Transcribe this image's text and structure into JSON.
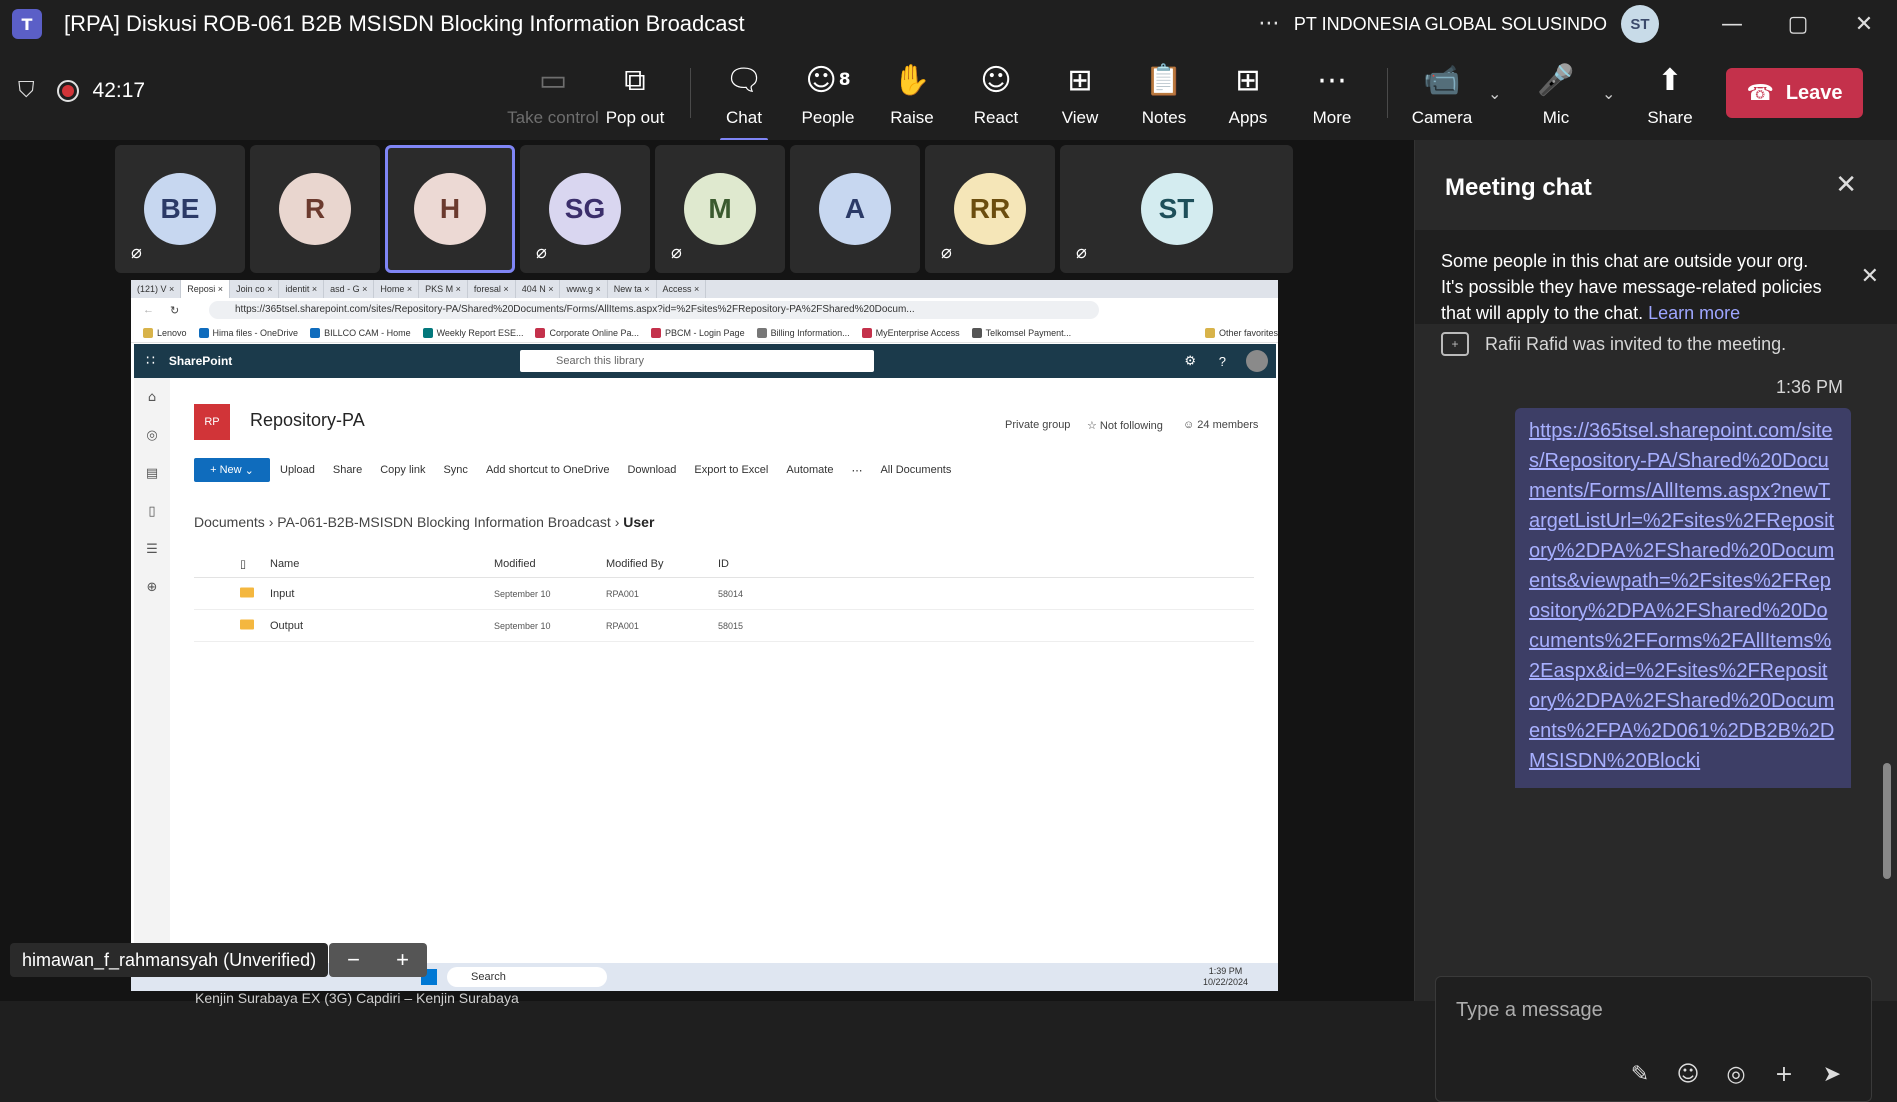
{
  "window": {
    "title": "[RPA] Diskusi ROB-061 B2B MSISDN Blocking Information Broadcast",
    "org": "PT INDONESIA GLOBAL SOLUSINDO",
    "user_initials": "ST",
    "more": "···",
    "minimize": "—",
    "maximize": "▢",
    "close": "✕"
  },
  "meeting": {
    "timer": "42:17"
  },
  "toolbar": {
    "take_control": "Take control",
    "pop_out": "Pop out",
    "chat": "Chat",
    "people": "People",
    "people_count": "8",
    "raise": "Raise",
    "react": "React",
    "view": "View",
    "notes": "Notes",
    "apps": "Apps",
    "more": "More",
    "camera": "Camera",
    "mic": "Mic",
    "share": "Share",
    "leave": "Leave"
  },
  "participants": [
    {
      "initials": "BE",
      "bg": "#c7d7f0",
      "fg": "#2b3a67",
      "muted": true
    },
    {
      "initials": "R",
      "bg": "#e9d6cf",
      "fg": "#6b3a2e",
      "muted": false
    },
    {
      "initials": "H",
      "bg": "#ecd9d4",
      "fg": "#6b3a2e",
      "muted": false
    },
    {
      "initials": "SG",
      "bg": "#d9d6f0",
      "fg": "#3b2e6b",
      "muted": true
    },
    {
      "initials": "M",
      "bg": "#dfe9cf",
      "fg": "#3a5a2e",
      "muted": true
    },
    {
      "initials": "A",
      "bg": "#c7d7f0",
      "fg": "#2b3a67",
      "muted": false
    },
    {
      "initials": "RR",
      "bg": "#f5e6b8",
      "fg": "#6b4d0e",
      "muted": true
    },
    {
      "initials": "ST",
      "bg": "#d4ecf0",
      "fg": "#1e4f5a",
      "muted": true
    }
  ],
  "shared_screen": {
    "tabs": [
      "(121) V",
      "Reposi",
      "Join co",
      "identit",
      "asd - G",
      "Home",
      "PKS M",
      "foresal",
      "404 N",
      "www.g",
      "New ta",
      "Access"
    ],
    "url": "https://365tsel.sharepoint.com/sites/Repository-PA/Shared%20Documents/Forms/AllItems.aspx?id=%2Fsites%2FRepository-PA%2FShared%20Docum...",
    "favorites": [
      "Lenovo",
      "Hima files - OneDrive",
      "BILLCO CAM - Home",
      "Weekly Report ESE...",
      "Corporate Online Pa...",
      "PBCM - Login Page",
      "Billing Information...",
      "MyEnterprise Access",
      "Telkomsel Payment...",
      "Other favorites"
    ],
    "app_name": "SharePoint",
    "search_placeholder": "Search this library",
    "site_logo": "RP",
    "site_name": "Repository-PA",
    "private_group": "Private group",
    "not_following": "Not following",
    "members": "24 members",
    "commands": {
      "new": "New",
      "upload": "Upload",
      "share": "Share",
      "copy_link": "Copy link",
      "sync": "Sync",
      "add_shortcut": "Add shortcut to OneDrive",
      "download": "Download",
      "export": "Export to Excel",
      "automate": "Automate",
      "view": "All Documents"
    },
    "breadcrumb": [
      "Documents",
      "PA-061-B2B-MSISDN Blocking Information Broadcast",
      "User"
    ],
    "columns": {
      "name": "Name",
      "modified": "Modified",
      "modified_by": "Modified By",
      "id": "ID"
    },
    "rows": [
      {
        "name": "Input",
        "modified": "September 10",
        "modified_by": "RPA001",
        "id": "58014"
      },
      {
        "name": "Output",
        "modified": "September 10",
        "modified_by": "RPA001",
        "id": "58015"
      }
    ],
    "taskbar_search": "Search",
    "clock_time": "1:39 PM",
    "clock_date": "10/22/2024"
  },
  "presenter": {
    "name": "himawan_f_rahmansyah (Unverified)"
  },
  "background_text": "Kenjin Surabaya EX (3G) Capdiri – Kenjin Surabaya",
  "chat": {
    "title": "Meeting chat",
    "banner_text": "Some people in this chat are outside your org. It's possible they have message-related policies that will apply to the chat.",
    "banner_link": "Learn more",
    "event": "Rafii Rafid was invited to the meeting.",
    "time": "1:36 PM",
    "message": "https://365tsel.sharepoint.com/sites/Repository-PA/Shared%20Documents/Forms/AllItems.aspx?newTargetListUrl=%2Fsites%2FRepository%2DPA%2FShared%20Documents&viewpath=%2Fsites%2FRepository%2DPA%2FShared%20Documents%2FForms%2FAllItems%2Easpx&id=%2Fsites%2FRepository%2DPA%2FShared%20Documents%2FPA%2D061%2DB2B%2DMSISDN%20Blocki",
    "placeholder": "Type a message"
  }
}
